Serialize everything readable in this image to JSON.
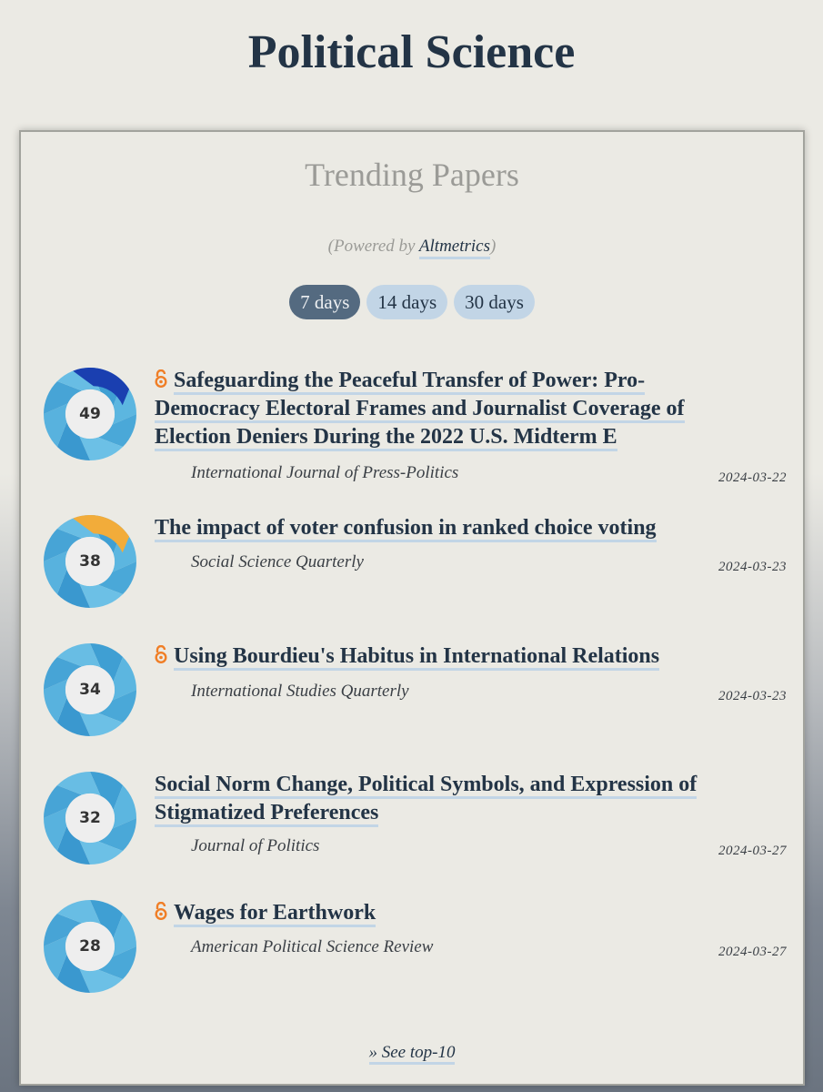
{
  "page": {
    "title": "Political Science"
  },
  "panel": {
    "title": "Trending Papers",
    "powered_prefix": "(Powered by ",
    "powered_link": "Altmetrics",
    "powered_suffix": ")"
  },
  "tabs": [
    {
      "label": "7 days",
      "active": true
    },
    {
      "label": "14 days",
      "active": false
    },
    {
      "label": "30 days",
      "active": false
    }
  ],
  "papers": [
    {
      "score": "49",
      "open_access": true,
      "title": "Safeguarding the Peaceful Transfer of Power: Pro-Democracy Electoral Frames and Journalist Coverage of Election Deniers During the 2022 U.S. Midterm E",
      "journal": "International Journal of Press-Politics",
      "date": "2024-03-22",
      "accent": "#1a3fb0"
    },
    {
      "score": "38",
      "open_access": false,
      "title": "The impact of voter confusion in ranked choice voting",
      "journal": "Social Science Quarterly",
      "date": "2024-03-23",
      "accent": "#f2ac3a"
    },
    {
      "score": "34",
      "open_access": true,
      "title": "Using Bourdieu's Habitus in International Relations",
      "journal": "International Studies Quarterly",
      "date": "2024-03-23",
      "accent": ""
    },
    {
      "score": "32",
      "open_access": false,
      "title": "Social Norm Change, Political Symbols, and Expression of Stigmatized Preferences",
      "journal": "Journal of Politics",
      "date": "2024-03-27",
      "accent": ""
    },
    {
      "score": "28",
      "open_access": true,
      "title": "Wages for Earthwork",
      "journal": "American Political Science Review",
      "date": "2024-03-27",
      "accent": ""
    }
  ],
  "footer": {
    "see_top_label": "» See top-10"
  },
  "colors": {
    "title": "#233446",
    "tab_active": "#546a80",
    "tab_inactive": "#c2d5e6",
    "open_access": "#f07e26",
    "donut_blue": "#4aa8d8"
  }
}
